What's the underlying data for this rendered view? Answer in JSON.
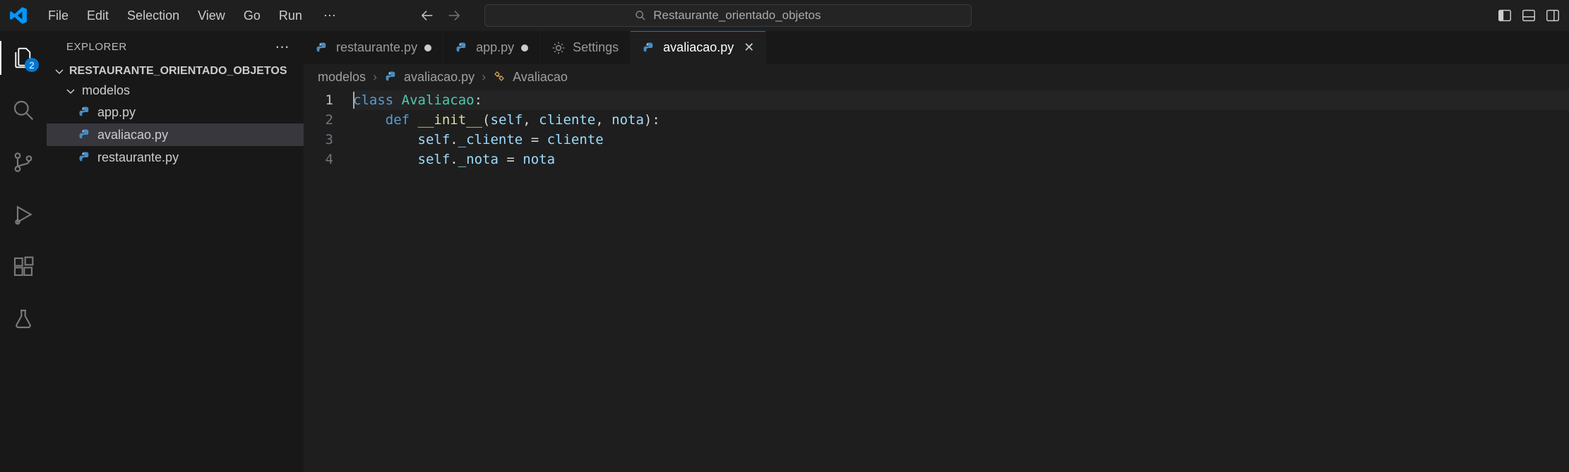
{
  "menu": {
    "file": "File",
    "edit": "Edit",
    "selection": "Selection",
    "view": "View",
    "go": "Go",
    "run": "Run"
  },
  "search": {
    "text": "Restaurante_orientado_objetos"
  },
  "activity": {
    "explorer_badge": "2"
  },
  "sidebar": {
    "title": "EXPLORER",
    "root": "RESTAURANTE_ORIENTADO_OBJETOS",
    "folder": "modelos",
    "files": {
      "app": "app.py",
      "avaliacao": "avaliacao.py",
      "restaurante": "restaurante.py"
    }
  },
  "tabs": {
    "restaurante": "restaurante.py",
    "app": "app.py",
    "settings": "Settings",
    "avaliacao": "avaliacao.py"
  },
  "breadcrumbs": {
    "folder": "modelos",
    "file": "avaliacao.py",
    "symbol": "Avaliacao"
  },
  "code": {
    "ln1": "1",
    "ln2": "2",
    "ln3": "3",
    "ln4": "4",
    "l1_kw": "class",
    "l1_name": " Avaliacao",
    "l1_colon": ":",
    "l2_indent": "    ",
    "l2_def": "def",
    "l2_fn": " __init__",
    "l2_open": "(",
    "l2_self": "self",
    "l2_c1": ", ",
    "l2_p1": "cliente",
    "l2_c2": ", ",
    "l2_p2": "nota",
    "l2_close": "):",
    "l3_indent": "        ",
    "l3_self": "self",
    "l3_dot": ".",
    "l3_attr": "_cliente",
    "l3_eq": " = ",
    "l3_val": "cliente",
    "l4_indent": "        ",
    "l4_self": "self",
    "l4_dot": ".",
    "l4_attr": "_nota",
    "l4_eq": " = ",
    "l4_val": "nota"
  }
}
